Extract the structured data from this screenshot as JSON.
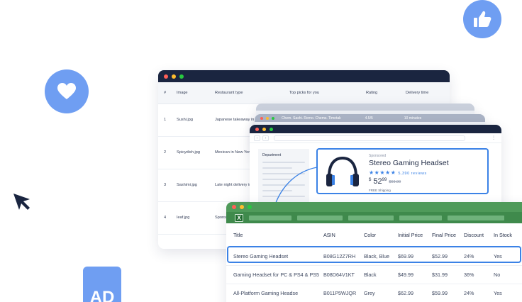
{
  "colors": {
    "accent": "#3b82e6",
    "badge_blue": "#6f9ef2",
    "excel_green": "#4f9a5a",
    "navy": "#1a2540"
  },
  "decor": {
    "ad_label": "AD",
    "icons": [
      "thumbs-up-icon",
      "heart-icon",
      "cursor-icon"
    ]
  },
  "restaurant_table": {
    "headers": [
      "#",
      "Image",
      "Restaurant type",
      "Top picks for you",
      "Rating",
      "Delivery time"
    ],
    "rows": [
      [
        "1",
        "Sushi.jpg",
        "Japanese takeaway in Coachella",
        "",
        "",
        ""
      ],
      [
        "2",
        "Spicydish.jpg",
        "Mexican in New York",
        "",
        "",
        ""
      ],
      [
        "3",
        "Sashimi.jpg",
        "Late night delivery in",
        "",
        "",
        ""
      ],
      [
        "4",
        "Ieaf.jpg",
        "Sponsored",
        "",
        "",
        ""
      ]
    ]
  },
  "stacked_window": {
    "title": "Chem. Sashi. Remo. Chems. Timetak",
    "rating": "4.5/5",
    "delivery": "10 minutes"
  },
  "product": {
    "sidebar_label": "Department",
    "sponsored": "Sponsored",
    "name": "Stereo Gaming Headset",
    "stars": "★★★★★",
    "reviews": "5,390 reviews",
    "price_symbol": "$",
    "price_whole": "52",
    "price_cents": "99",
    "price_old": "$69.99",
    "shipping": "FREE Shipping"
  },
  "sheet": {
    "headers": [
      "Title",
      "ASIN",
      "Color",
      "Initial Price",
      "Final Price",
      "Discount",
      "In Stock"
    ],
    "rows": [
      [
        "Stereo Gaming Headset",
        "B08G12Z7RH",
        "Black, Blue",
        "$69.99",
        "$52.99",
        "24%",
        "Yes"
      ],
      [
        "Gaming Headset for PC & PS4 & PS5",
        "B08D64V1KT",
        "Black",
        "$49.99",
        "$31.99",
        "36%",
        "No"
      ],
      [
        "All-Platform Gaming Headse",
        "B011P5WJQR",
        "Grey",
        "$62.99",
        "$59.99",
        "24%",
        "Yes"
      ]
    ],
    "logo": "X"
  }
}
